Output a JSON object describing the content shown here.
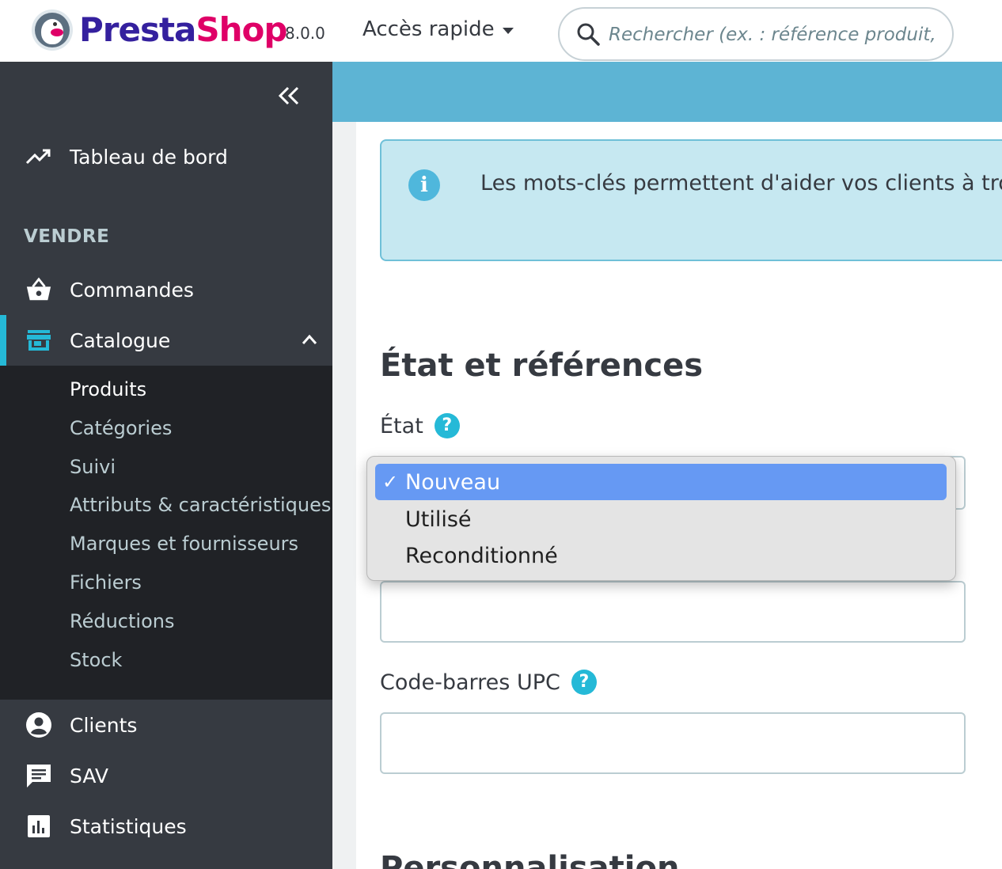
{
  "header": {
    "logo_part1": "Presta",
    "logo_part2": "Shop",
    "version": "8.0.0",
    "quick_access": "Accès rapide",
    "search_placeholder": "Rechercher (ex. : référence produit, no"
  },
  "sidebar": {
    "dashboard": "Tableau de bord",
    "section_sell": "VENDRE",
    "orders": "Commandes",
    "catalog": "Catalogue",
    "catalog_sub": [
      "Produits",
      "Catégories",
      "Suivi",
      "Attributs & caractéristiques",
      "Marques et fournisseurs",
      "Fichiers",
      "Réductions",
      "Stock"
    ],
    "customers": "Clients",
    "support": "SAV",
    "stats": "Statistiques"
  },
  "content": {
    "alert_text": "Les mots-clés permettent d'aider vos clients à tro",
    "section_title": "État et références",
    "state_label": "État",
    "help_glyph": "?",
    "upc_label": "Code-barres UPC",
    "next_section": "Personnalisation"
  },
  "dropdown": {
    "check": "✓",
    "options": [
      "Nouveau",
      "Utilisé",
      "Reconditionné"
    ],
    "selected": "Nouveau"
  },
  "colors": {
    "sidebar_bg": "#363a41",
    "submenu_bg": "#202226",
    "accent": "#25b9d7",
    "band": "#5db4d4",
    "selected_option": "#6699f3"
  }
}
